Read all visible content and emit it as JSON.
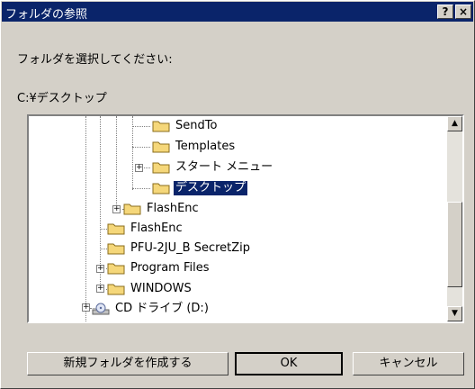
{
  "window": {
    "title": "フォルダの参照",
    "help_label": "?",
    "close_label": "×"
  },
  "prompt": "フォルダを選択してください:",
  "current_path": "C:¥デスクトップ",
  "tree": {
    "items": [
      {
        "label": "SendTo"
      },
      {
        "label": "Templates"
      },
      {
        "label": "スタート メニュー"
      },
      {
        "label": "デスクトップ",
        "selected": true
      },
      {
        "label": "FlashEnc"
      },
      {
        "label": "FlashEnc"
      },
      {
        "label": "PFU-2JU_B SecretZip"
      },
      {
        "label": "Program Files"
      },
      {
        "label": "WINDOWS"
      },
      {
        "label": "CD ドライブ (D:)"
      }
    ]
  },
  "buttons": {
    "new_folder": "新規フォルダを作成する",
    "ok": "OK",
    "cancel": "キャンセル"
  },
  "colors": {
    "titlebar": "#0a246a",
    "selection": "#0a246a",
    "face": "#d4d0c8",
    "folder": "#f5d77a"
  }
}
